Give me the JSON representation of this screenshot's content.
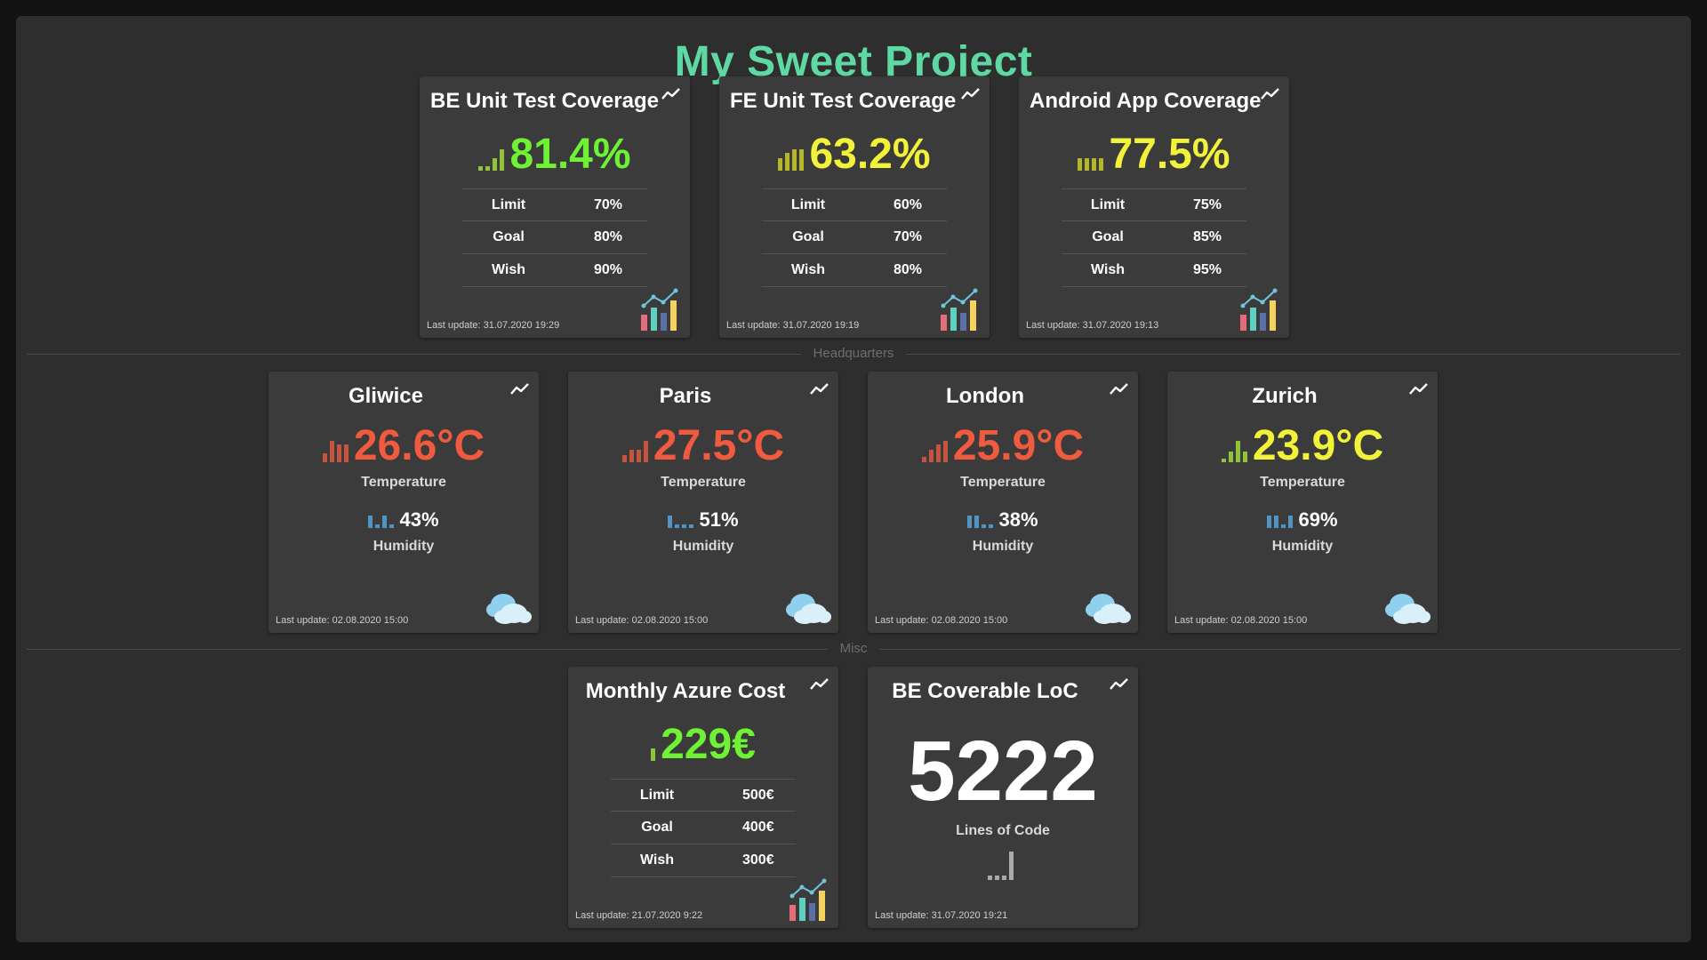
{
  "page": {
    "title": "My Sweet Project"
  },
  "colors": {
    "title": "#5fd9a3",
    "green": "#6ef233",
    "yellow": "#f2f23a",
    "red": "#f05a3e",
    "humidity": "#4f94c2",
    "neutral": "#ffffff"
  },
  "coverage": [
    {
      "title": "BE Unit Test Coverage",
      "value": "81.4%",
      "rows": [
        {
          "label": "Limit",
          "value": "70%"
        },
        {
          "label": "Goal",
          "value": "80%"
        },
        {
          "label": "Wish",
          "value": "90%"
        }
      ],
      "last_update": "Last update: 31.07.2020 19:29",
      "icons": [
        "trend-icon",
        "signal-bars-icon",
        "bar-chart-icon"
      ]
    },
    {
      "title": "FE Unit Test Coverage",
      "value": "63.2%",
      "rows": [
        {
          "label": "Limit",
          "value": "60%"
        },
        {
          "label": "Goal",
          "value": "70%"
        },
        {
          "label": "Wish",
          "value": "80%"
        }
      ],
      "last_update": "Last update: 31.07.2020 19:19",
      "icons": [
        "trend-icon",
        "signal-bars-icon",
        "bar-chart-icon"
      ]
    },
    {
      "title": "Android App Coverage",
      "value": "77.5%",
      "rows": [
        {
          "label": "Limit",
          "value": "75%"
        },
        {
          "label": "Goal",
          "value": "85%"
        },
        {
          "label": "Wish",
          "value": "95%"
        }
      ],
      "last_update": "Last update: 31.07.2020 19:13",
      "icons": [
        "trend-icon",
        "signal-bars-icon",
        "bar-chart-icon"
      ]
    }
  ],
  "sections": {
    "headquarters": "Headquarters",
    "misc": "Misc"
  },
  "weather": [
    {
      "city": "Gliwice",
      "temperature": "26.6°C",
      "temperature_caption": "Temperature",
      "humidity": "43%",
      "humidity_caption": "Humidity",
      "last_update": "Last update: 02.08.2020 15:00"
    },
    {
      "city": "Paris",
      "temperature": "27.5°C",
      "temperature_caption": "Temperature",
      "humidity": "51%",
      "humidity_caption": "Humidity",
      "last_update": "Last update: 02.08.2020 15:00"
    },
    {
      "city": "London",
      "temperature": "25.9°C",
      "temperature_caption": "Temperature",
      "humidity": "38%",
      "humidity_caption": "Humidity",
      "last_update": "Last update: 02.08.2020 15:00"
    },
    {
      "city": "Zurich",
      "temperature": "23.9°C",
      "temperature_caption": "Temperature",
      "humidity": "69%",
      "humidity_caption": "Humidity",
      "last_update": "Last update: 02.08.2020 15:00"
    }
  ],
  "azure": {
    "title": "Monthly Azure Cost",
    "value": "229€",
    "rows": [
      {
        "label": "Limit",
        "value": "500€"
      },
      {
        "label": "Goal",
        "value": "400€"
      },
      {
        "label": "Wish",
        "value": "300€"
      }
    ],
    "last_update": "Last update: 21.07.2020 9:22"
  },
  "loc": {
    "title": "BE Coverable LoC",
    "value": "5222",
    "caption": "Lines of Code",
    "last_update": "Last update: 31.07.2020 19:21"
  }
}
